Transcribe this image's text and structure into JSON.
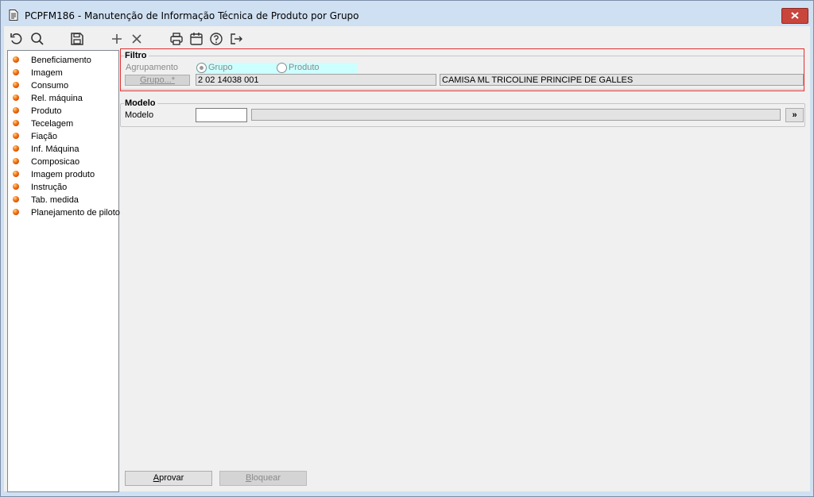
{
  "window": {
    "title": "PCPFM186 - Manutenção de Informação Técnica de Produto por Grupo"
  },
  "toolbar": {
    "icons": [
      "undo-icon",
      "search-icon",
      "save-icon",
      "add-icon",
      "delete-icon",
      "print-icon",
      "calendar-icon",
      "help-icon",
      "exit-icon"
    ]
  },
  "sidebar": {
    "items": [
      {
        "label": "Beneficiamento"
      },
      {
        "label": "Imagem"
      },
      {
        "label": "Consumo"
      },
      {
        "label": "Rel. máquina"
      },
      {
        "label": "Produto"
      },
      {
        "label": "Tecelagem"
      },
      {
        "label": "Fiação"
      },
      {
        "label": "Inf. Máquina"
      },
      {
        "label": "Composicao"
      },
      {
        "label": "Imagem produto"
      },
      {
        "label": "Instrução"
      },
      {
        "label": "Tab. medida"
      },
      {
        "label": "Planejamento de piloto"
      }
    ]
  },
  "filtro": {
    "title": "Filtro",
    "agrupamento_label": "Agrupamento",
    "radio_grupo": "Grupo",
    "radio_produto": "Produto",
    "selected": "Grupo",
    "grupo_button": "Grupo...*",
    "grupo_code": "2 02 14038 001",
    "grupo_desc": "CAMISA ML TRICOLINE PRINCIPE DE GALLES"
  },
  "modelo": {
    "title": "Modelo",
    "label": "Modelo",
    "code": "",
    "desc": "",
    "browse_button": "»"
  },
  "footer": {
    "aprovar": "Aprovar",
    "bloquear": "Bloquear"
  },
  "colors": {
    "highlight_frame": "#e3302f",
    "radio_highlight": "#ccffff",
    "close_button": "#c9463d"
  }
}
